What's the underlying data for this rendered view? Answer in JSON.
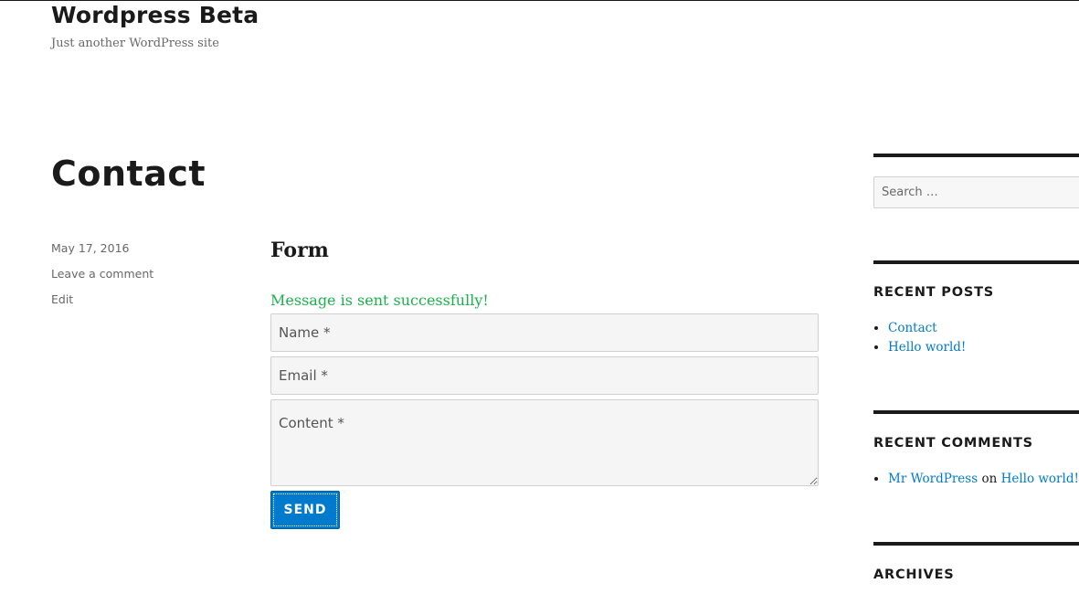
{
  "header": {
    "site_title": "Wordpress Beta",
    "site_description": "Just another WordPress site"
  },
  "article": {
    "title": "Contact",
    "meta": {
      "date": "May 17, 2016",
      "comment_link": "Leave a comment",
      "edit_link": "Edit"
    },
    "form": {
      "title": "Form",
      "success_message": "Message is sent successfully!",
      "name_placeholder": "Name *",
      "email_placeholder": "Email *",
      "content_placeholder": "Content *",
      "send_label": "SEND"
    }
  },
  "sidebar": {
    "search": {
      "placeholder": "Search …"
    },
    "recent_posts": {
      "title": "RECENT POSTS",
      "items": [
        "Contact",
        "Hello world!"
      ]
    },
    "recent_comments": {
      "title": "RECENT COMMENTS",
      "author": "Mr WordPress",
      "connector": "on",
      "post": "Hello world!"
    },
    "archives": {
      "title": "ARCHIVES"
    }
  },
  "colors": {
    "link": "#007acc",
    "success": "#1bb14a",
    "button": "#007acc",
    "text": "#1a1a1a",
    "meta": "#686868"
  }
}
